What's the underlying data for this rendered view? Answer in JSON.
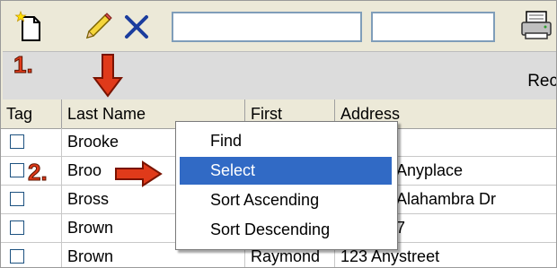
{
  "toolbar": {
    "buttons": [
      {
        "name": "new-record-button",
        "icon": "new-document-icon"
      },
      {
        "name": "edit-record-button",
        "icon": "pencil-icon"
      },
      {
        "name": "delete-record-button",
        "icon": "delete-x-icon"
      },
      {
        "name": "print-button",
        "icon": "printer-icon"
      }
    ],
    "input1_value": "",
    "input2_value": ""
  },
  "status_bar": {
    "text": "Rec"
  },
  "annotations": {
    "step1": "1.",
    "step2": "2."
  },
  "table": {
    "columns": [
      "Tag",
      "Last Name",
      "First",
      "Address"
    ],
    "rows": [
      {
        "tag": false,
        "last": "Brooke",
        "first": "",
        "address": ""
      },
      {
        "tag": false,
        "last": "Broo",
        "first": "",
        "address": "Anyplace"
      },
      {
        "tag": false,
        "last": "Bross",
        "first": "",
        "address": "Alahambra Dr"
      },
      {
        "tag": false,
        "last": "Brown",
        "first": "",
        "address": "7"
      },
      {
        "tag": false,
        "last": "Brown",
        "first": "Raymond",
        "address": "123 Anystreet"
      }
    ]
  },
  "context_menu": {
    "items": [
      "Find",
      "Select",
      "Sort Ascending",
      "Sort Descending"
    ],
    "selected": "Select"
  },
  "colors": {
    "highlight": "#316ac5",
    "annotation": "#e03a1a",
    "delete_x": "#1b3d9e"
  }
}
